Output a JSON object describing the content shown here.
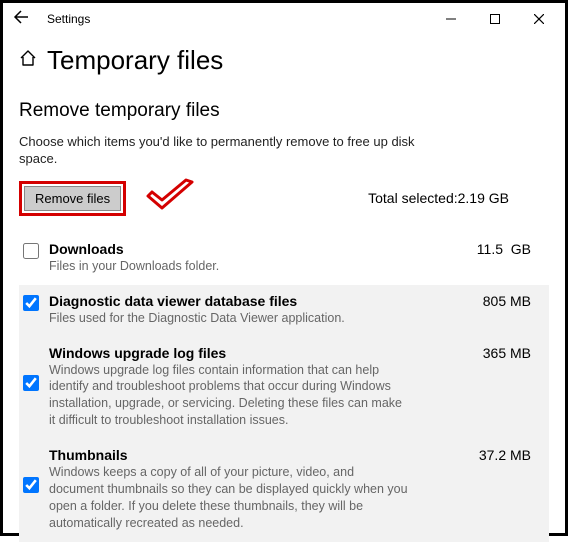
{
  "window": {
    "app_title": "Settings"
  },
  "page": {
    "title": "Temporary files",
    "subtitle": "Remove temporary files",
    "description": "Choose which items you'd like to permanently remove to free up disk space."
  },
  "actions": {
    "remove_label": "Remove files",
    "total_label": "Total selected:",
    "total_value": "2.19 GB"
  },
  "items": [
    {
      "name": "Downloads",
      "desc": "Files in your Downloads folder.",
      "size": "11.5  GB",
      "checked": false
    },
    {
      "name": "Diagnostic data viewer database files",
      "desc": "Files used for the Diagnostic Data Viewer application.",
      "size": "805 MB",
      "checked": true
    },
    {
      "name": "Windows upgrade log files",
      "desc": "Windows upgrade log files contain information that can help identify and troubleshoot problems that occur during Windows installation, upgrade, or servicing.  Deleting these files can make it difficult to troubleshoot installation issues.",
      "size": "365 MB",
      "checked": true
    },
    {
      "name": "Thumbnails",
      "desc": "Windows keeps a copy of all of your picture, video, and document thumbnails so they can be displayed quickly when you open a folder. If you delete these thumbnails, they will be automatically recreated as needed.",
      "size": "37.2 MB",
      "checked": true
    }
  ]
}
